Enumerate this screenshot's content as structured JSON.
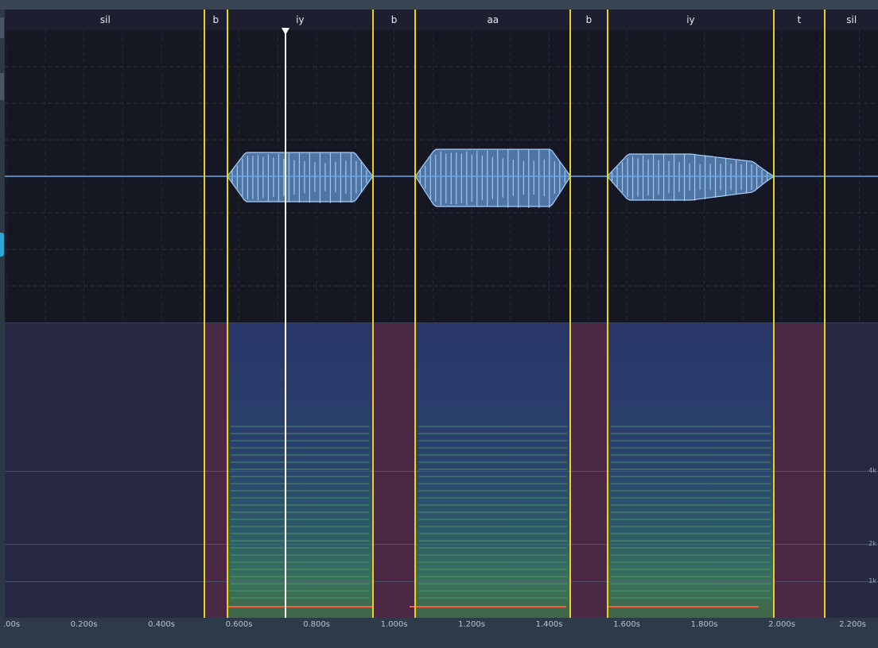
{
  "phonemes": [
    {
      "label": "sil",
      "start": 0.0,
      "end": 0.51
    },
    {
      "label": "b",
      "start": 0.51,
      "end": 0.57
    },
    {
      "label": "iy",
      "start": 0.57,
      "end": 0.945
    },
    {
      "label": "b",
      "start": 0.945,
      "end": 1.055
    },
    {
      "label": "aa",
      "start": 1.055,
      "end": 1.455
    },
    {
      "label": "b",
      "start": 1.455,
      "end": 1.55
    },
    {
      "label": "iy",
      "start": 1.55,
      "end": 1.98
    },
    {
      "label": "t",
      "start": 1.98,
      "end": 2.11
    },
    {
      "label": "sil",
      "start": 2.11,
      "end": 2.25
    }
  ],
  "time_axis": {
    "ticks": [
      {
        "t": 0.0,
        "label": ".00s"
      },
      {
        "t": 0.2,
        "label": "0.200s"
      },
      {
        "t": 0.4,
        "label": "0.400s"
      },
      {
        "t": 0.6,
        "label": "0.600s"
      },
      {
        "t": 0.8,
        "label": "0.800s"
      },
      {
        "t": 1.0,
        "label": "1.000s"
      },
      {
        "t": 1.2,
        "label": "1.200s"
      },
      {
        "t": 1.4,
        "label": "1.400s"
      },
      {
        "t": 1.6,
        "label": "1.600s"
      },
      {
        "t": 1.8,
        "label": "1.800s"
      },
      {
        "t": 2.0,
        "label": "2.000s"
      },
      {
        "t": 2.2,
        "label": "2.200s"
      }
    ]
  },
  "spectrogram": {
    "freq_labels": [
      {
        "hz": 4000,
        "label": "4k"
      },
      {
        "hz": 2000,
        "label": "2k"
      },
      {
        "hz": 1000,
        "label": "1k"
      }
    ]
  },
  "playhead_time": 0.72,
  "pitch_segments": [
    {
      "start": 0.57,
      "end": 0.945
    },
    {
      "start": 1.04,
      "end": 1.445
    },
    {
      "start": 1.55,
      "end": 1.94
    }
  ],
  "colors": {
    "boundary": "#e8d21a",
    "waveform": "#6aa8e6",
    "playhead": "#ffffff",
    "pitch": "#ff5a3c",
    "consonant_band": "#6a2a48"
  }
}
